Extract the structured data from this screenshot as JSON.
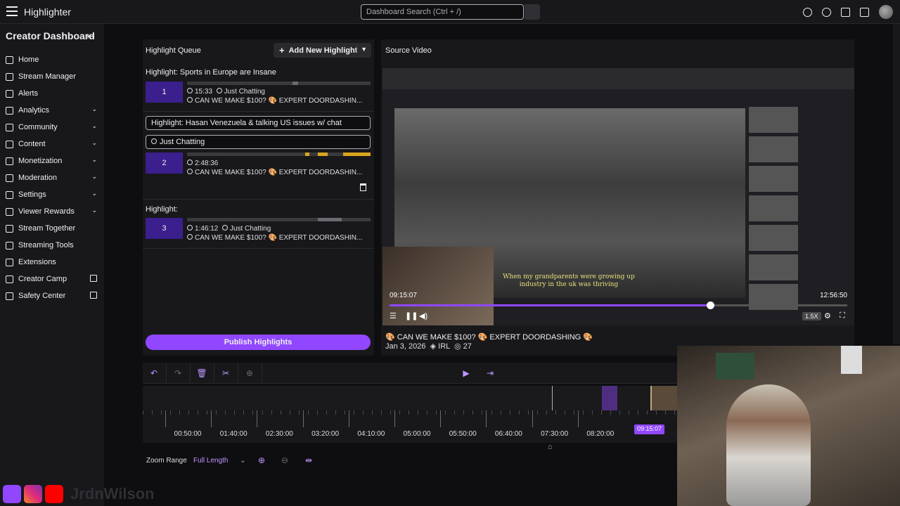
{
  "app": {
    "title": "Highlighter"
  },
  "search": {
    "placeholder": "Dashboard Search (Ctrl + /)"
  },
  "sidebar": {
    "title": "Creator Dashboard",
    "items": [
      {
        "label": "Home",
        "chevron": false,
        "external": false
      },
      {
        "label": "Stream Manager",
        "chevron": false,
        "external": false
      },
      {
        "label": "Alerts",
        "chevron": false,
        "external": false
      },
      {
        "label": "Analytics",
        "chevron": true,
        "external": false
      },
      {
        "label": "Community",
        "chevron": true,
        "external": false
      },
      {
        "label": "Content",
        "chevron": true,
        "external": false
      },
      {
        "label": "Monetization",
        "chevron": true,
        "external": false
      },
      {
        "label": "Moderation",
        "chevron": true,
        "external": false
      },
      {
        "label": "Settings",
        "chevron": true,
        "external": false
      },
      {
        "label": "Viewer Rewards",
        "chevron": true,
        "external": false
      },
      {
        "label": "Stream Together",
        "chevron": false,
        "external": false
      },
      {
        "label": "Streaming Tools",
        "chevron": false,
        "external": false
      },
      {
        "label": "Extensions",
        "chevron": false,
        "external": false
      },
      {
        "label": "Creator Camp",
        "chevron": false,
        "external": true
      },
      {
        "label": "Safety Center",
        "chevron": false,
        "external": true
      }
    ]
  },
  "queue": {
    "title": "Highlight Queue",
    "add_label": "Add New Highlight",
    "highlights": [
      {
        "title": "Highlight: Sports in Europe are Insane",
        "num": "1",
        "duration": "15:33",
        "category": "Just Chatting",
        "stream": "CAN WE MAKE $100? 🎨 EXPERT DOORDASHIN..."
      },
      {
        "title": "Highlight: Hasan Venezuela & talking US issues w/ chat",
        "num": "2",
        "duration": "2:48:36",
        "category": "Just Chatting",
        "stream": "CAN WE MAKE $100? 🎨 EXPERT DOORDASHIN..."
      },
      {
        "title": "Highlight:",
        "num": "3",
        "duration": "1:46:12",
        "category": "Just Chatting",
        "stream": "CAN WE MAKE $100? 🎨 EXPERT DOORDASHIN..."
      }
    ],
    "publish_label": "Publish Highlights"
  },
  "source": {
    "title": "Source Video",
    "subtitle_line1": "When my grandparents were growing up",
    "subtitle_line2": "industry in the uk was thriving",
    "time_left": "09:15:07",
    "time_right": "12:56:50",
    "progress": 0.7,
    "speed": "1.5X",
    "video_name": "🎨 CAN WE MAKE $100? 🎨 EXPERT DOORDASHING 🎨",
    "date": "Jan 3, 2026",
    "category": "IRL",
    "views": "27"
  },
  "timeline": {
    "ticks": [
      "00:50:00",
      "01:40:00",
      "02:30:00",
      "03:20:00",
      "04:10:00",
      "05:00:00",
      "05:50:00",
      "06:40:00",
      "07:30:00",
      "08:20:00"
    ],
    "playhead": "09:15:07",
    "zoom_label": "Zoom Range",
    "zoom_value": "Full Length"
  },
  "branding": {
    "handle": "JrdnWilson"
  },
  "colors": {
    "accent": "#9147ff",
    "panel": "#18181b",
    "bg": "#0e0e10",
    "gold": "#d9a51f"
  }
}
